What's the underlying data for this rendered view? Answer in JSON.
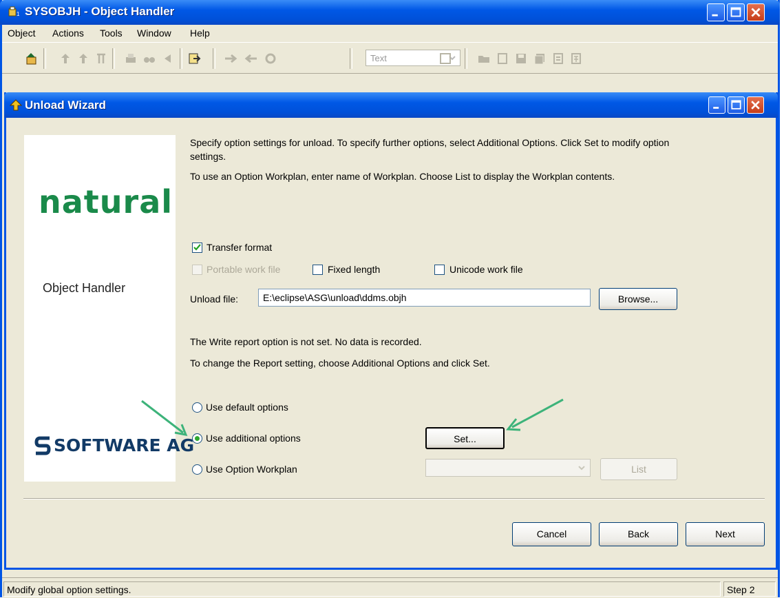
{
  "window": {
    "title": "SYSOBJH - Object Handler"
  },
  "menu": [
    "Object",
    "Actions",
    "Tools",
    "Window",
    "Help"
  ],
  "toolbar": {
    "combo_value": "Text"
  },
  "wizard": {
    "title": "Unload Wizard",
    "branding": {
      "product": "natural",
      "subtitle": "Object Handler",
      "vendor": "SOFTWARE AG"
    },
    "instructions": [
      "Specify option settings for unload. To specify further options, select Additional Options. Click Set to modify option",
      "settings.",
      "To use an Option Workplan, enter name of Workplan. Choose List to display the  Workplan contents."
    ],
    "transfer_format": {
      "label": "Transfer format",
      "checked": true
    },
    "portable_work_file": {
      "label": "Portable work file",
      "checked": false,
      "disabled": true
    },
    "fixed_length": {
      "label": "Fixed length",
      "checked": false
    },
    "unicode_work_file": {
      "label": "Unicode work file",
      "checked": false
    },
    "unload_file": {
      "label": "Unload file:",
      "value": "E:\\eclipse\\ASG\\unload\\ddms.objh"
    },
    "browse_label": "Browse...",
    "report_note": "The Write report option is not set. No data is recorded.",
    "report_hint": "To change the Report setting, choose Additional Options and click Set.",
    "options": [
      {
        "label": "Use default options",
        "selected": false
      },
      {
        "label": "Use additional options",
        "selected": true
      },
      {
        "label": "Use Option Workplan",
        "selected": false
      }
    ],
    "set_label": "Set...",
    "list_label": "List",
    "cancel_label": "Cancel",
    "back_label": "Back",
    "next_label": "Next"
  },
  "status": {
    "message": "Modify global option settings.",
    "step": "Step 2"
  },
  "colors": {
    "titlebar": "#0058e6",
    "face": "#ece9d8",
    "arrow": "#3db37a",
    "brand_green": "#1a8a4a"
  }
}
